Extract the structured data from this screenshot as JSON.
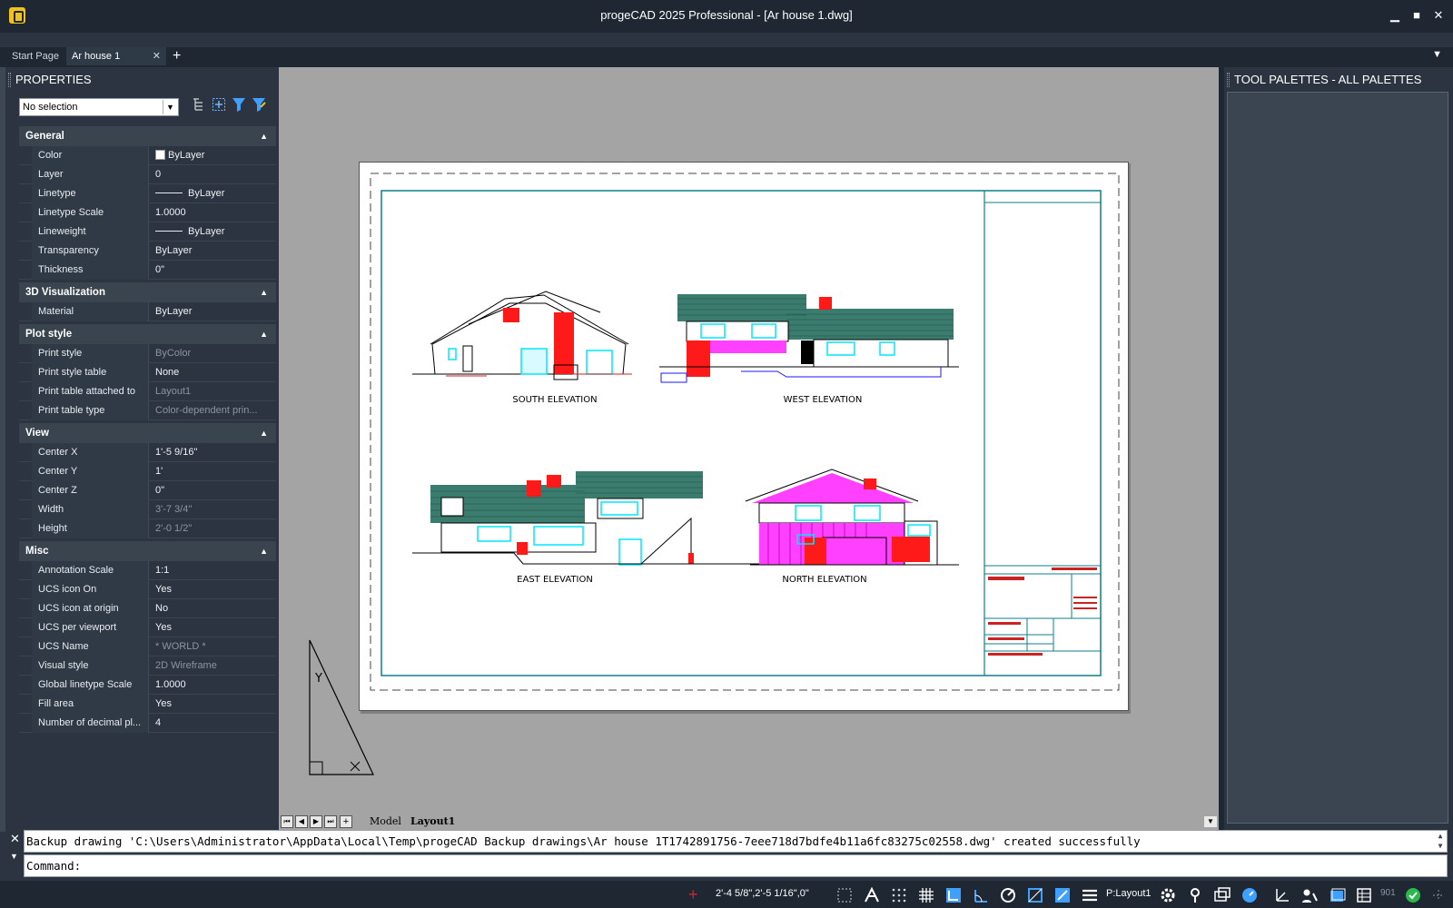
{
  "window": {
    "title": "progeCAD 2025 Professional - [Ar house 1.dwg]",
    "minimize": "▁",
    "maximize": "■",
    "close": "✕"
  },
  "tabs": {
    "start": "Start Page",
    "doc": "Ar house 1",
    "close": "✕",
    "add": "+",
    "menu": "▼"
  },
  "properties": {
    "title": "PROPERTIES",
    "selection": "No selection",
    "categories": [
      {
        "name": "General",
        "rows": [
          {
            "label": "Color",
            "value": "ByLayer"
          },
          {
            "label": "Layer",
            "value": "0"
          },
          {
            "label": "Linetype",
            "value": "ByLayer"
          },
          {
            "label": "Linetype Scale",
            "value": "1.0000"
          },
          {
            "label": "Lineweight",
            "value": "ByLayer"
          },
          {
            "label": "Transparency",
            "value": "ByLayer"
          },
          {
            "label": "Thickness",
            "value": "0\""
          }
        ]
      },
      {
        "name": "3D Visualization",
        "rows": [
          {
            "label": "Material",
            "value": "ByLayer"
          }
        ]
      },
      {
        "name": "Plot style",
        "rows": [
          {
            "label": "Print style",
            "value": "ByColor"
          },
          {
            "label": "Print style table",
            "value": "None"
          },
          {
            "label": "Print table attached to",
            "value": "Layout1"
          },
          {
            "label": "Print table type",
            "value": "Color-dependent prin..."
          }
        ]
      },
      {
        "name": "View",
        "rows": [
          {
            "label": "Center X",
            "value": "1'-5 9/16\""
          },
          {
            "label": "Center Y",
            "value": "1'"
          },
          {
            "label": "Center Z",
            "value": "0\""
          },
          {
            "label": "Width",
            "value": "3'-7 3/4\""
          },
          {
            "label": "Height",
            "value": "2'-0 1/2\""
          }
        ]
      },
      {
        "name": "Misc",
        "rows": [
          {
            "label": "Annotation Scale",
            "value": "1:1"
          },
          {
            "label": "UCS icon On",
            "value": "Yes"
          },
          {
            "label": "UCS icon at origin",
            "value": "No"
          },
          {
            "label": "UCS per viewport",
            "value": "Yes"
          },
          {
            "label": "UCS Name",
            "value": "* WORLD *"
          },
          {
            "label": "Visual style",
            "value": "2D Wireframe"
          },
          {
            "label": "Global linetype Scale",
            "value": "1.0000"
          },
          {
            "label": "Fill area",
            "value": "Yes"
          },
          {
            "label": "Number of decimal pl...",
            "value": "4"
          }
        ]
      }
    ]
  },
  "drawing": {
    "labels": {
      "south": "SOUTH ELEVATION",
      "west": "WEST ELEVATION",
      "east": "EAST ELEVATION",
      "north": "NORTH ELEVATION"
    },
    "ucs_y": "Y"
  },
  "layout_tabs": {
    "model": "Model",
    "layout1": "Layout1"
  },
  "tool_palettes": {
    "title": "TOOL PALETTES - ALL PALETTES"
  },
  "command": {
    "history": "Backup drawing 'C:\\Users\\Administrator\\AppData\\Local\\Temp\\progeCAD Backup drawings\\Ar house 1T1742891756-7eee718d7bdfe4b11a6fc83275c02558.dwg' created successfully",
    "prompt": "Command:"
  },
  "status": {
    "coords": "2'-4 5/8\",2'-5 1/16\",0\"",
    "layout": "P:Layout1",
    "number": "901"
  },
  "colors": {
    "accent_red": "#ff1a1a",
    "cyan": "#00e5ff",
    "roof_green": "#3a7d6e",
    "magenta": "#ff40ff",
    "frame_teal": "#0e7f8c"
  }
}
